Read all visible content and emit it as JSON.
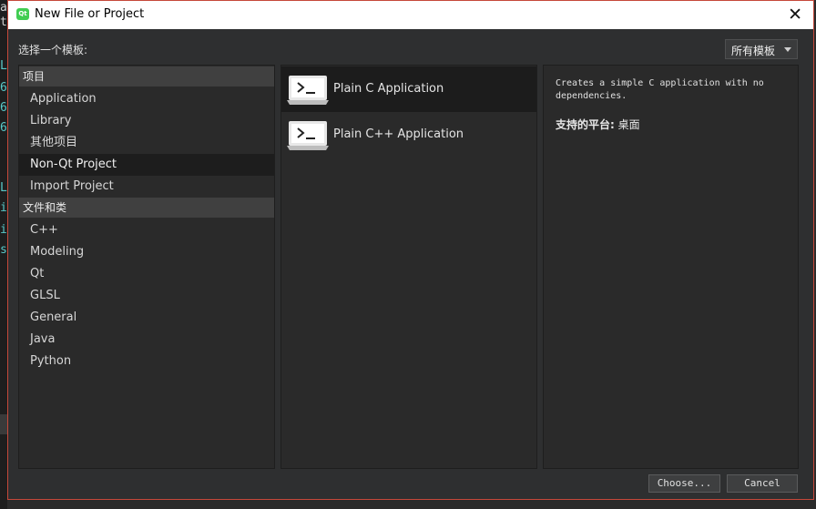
{
  "background_editor": {
    "glyphs": [
      {
        "text": "a",
        "color": "#d0d0d0"
      },
      {
        "text": "t",
        "color": "#d0d0d0"
      },
      {
        "text": "L",
        "color": "#59c8c8"
      },
      {
        "text": "6",
        "color": "#59c8c8"
      },
      {
        "text": "6",
        "color": "#59c8c8"
      },
      {
        "text": "6",
        "color": "#59c8c8"
      },
      {
        "text": "L",
        "color": "#59c8c8"
      },
      {
        "text": "i",
        "color": "#59c8c8"
      },
      {
        "text": "i",
        "color": "#59c8c8"
      },
      {
        "text": "s",
        "color": "#59c8c8"
      }
    ]
  },
  "window": {
    "title": "New File or Project",
    "logo_text": "Qt",
    "close_glyph": "✕"
  },
  "header": {
    "choose_template_label": "选择一个模板:",
    "filter": {
      "selected": "所有模板"
    }
  },
  "categories": {
    "group1": {
      "title": "项目",
      "items": [
        "Application",
        "Library",
        "其他项目",
        "Non-Qt Project",
        "Import Project"
      ],
      "selected": "Non-Qt Project"
    },
    "group2": {
      "title": "文件和类",
      "items": [
        "C++",
        "Modeling",
        "Qt",
        "GLSL",
        "General",
        "Java",
        "Python"
      ]
    }
  },
  "templates": [
    {
      "label": "Plain C Application",
      "icon": "terminal-icon",
      "selected": true
    },
    {
      "label": "Plain C++ Application",
      "icon": "terminal-icon",
      "selected": false
    }
  ],
  "description": {
    "text": "Creates a simple C application with no dependencies.",
    "platforms_label": "支持的平台:",
    "platforms_value": "桌面"
  },
  "buttons": {
    "choose": "Choose...",
    "cancel": "Cancel"
  },
  "colors": {
    "dialog_bg": "#2e2f30",
    "border_accent": "#c6483a",
    "qt_green": "#41cd52",
    "selected_bg": "#1d1d1d"
  }
}
